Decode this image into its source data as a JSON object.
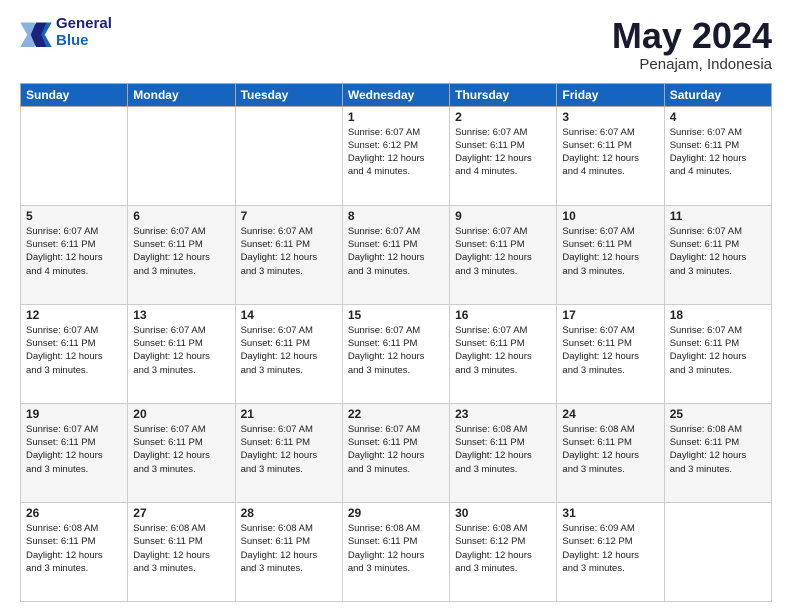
{
  "logo": {
    "line1": "General",
    "line2": "Blue"
  },
  "title": "May 2024",
  "subtitle": "Penajam, Indonesia",
  "weekdays": [
    "Sunday",
    "Monday",
    "Tuesday",
    "Wednesday",
    "Thursday",
    "Friday",
    "Saturday"
  ],
  "weeks": [
    [
      {
        "day": "",
        "info": ""
      },
      {
        "day": "",
        "info": ""
      },
      {
        "day": "",
        "info": ""
      },
      {
        "day": "1",
        "info": "Sunrise: 6:07 AM\nSunset: 6:12 PM\nDaylight: 12 hours\nand 4 minutes."
      },
      {
        "day": "2",
        "info": "Sunrise: 6:07 AM\nSunset: 6:11 PM\nDaylight: 12 hours\nand 4 minutes."
      },
      {
        "day": "3",
        "info": "Sunrise: 6:07 AM\nSunset: 6:11 PM\nDaylight: 12 hours\nand 4 minutes."
      },
      {
        "day": "4",
        "info": "Sunrise: 6:07 AM\nSunset: 6:11 PM\nDaylight: 12 hours\nand 4 minutes."
      }
    ],
    [
      {
        "day": "5",
        "info": "Sunrise: 6:07 AM\nSunset: 6:11 PM\nDaylight: 12 hours\nand 4 minutes."
      },
      {
        "day": "6",
        "info": "Sunrise: 6:07 AM\nSunset: 6:11 PM\nDaylight: 12 hours\nand 3 minutes."
      },
      {
        "day": "7",
        "info": "Sunrise: 6:07 AM\nSunset: 6:11 PM\nDaylight: 12 hours\nand 3 minutes."
      },
      {
        "day": "8",
        "info": "Sunrise: 6:07 AM\nSunset: 6:11 PM\nDaylight: 12 hours\nand 3 minutes."
      },
      {
        "day": "9",
        "info": "Sunrise: 6:07 AM\nSunset: 6:11 PM\nDaylight: 12 hours\nand 3 minutes."
      },
      {
        "day": "10",
        "info": "Sunrise: 6:07 AM\nSunset: 6:11 PM\nDaylight: 12 hours\nand 3 minutes."
      },
      {
        "day": "11",
        "info": "Sunrise: 6:07 AM\nSunset: 6:11 PM\nDaylight: 12 hours\nand 3 minutes."
      }
    ],
    [
      {
        "day": "12",
        "info": "Sunrise: 6:07 AM\nSunset: 6:11 PM\nDaylight: 12 hours\nand 3 minutes."
      },
      {
        "day": "13",
        "info": "Sunrise: 6:07 AM\nSunset: 6:11 PM\nDaylight: 12 hours\nand 3 minutes."
      },
      {
        "day": "14",
        "info": "Sunrise: 6:07 AM\nSunset: 6:11 PM\nDaylight: 12 hours\nand 3 minutes."
      },
      {
        "day": "15",
        "info": "Sunrise: 6:07 AM\nSunset: 6:11 PM\nDaylight: 12 hours\nand 3 minutes."
      },
      {
        "day": "16",
        "info": "Sunrise: 6:07 AM\nSunset: 6:11 PM\nDaylight: 12 hours\nand 3 minutes."
      },
      {
        "day": "17",
        "info": "Sunrise: 6:07 AM\nSunset: 6:11 PM\nDaylight: 12 hours\nand 3 minutes."
      },
      {
        "day": "18",
        "info": "Sunrise: 6:07 AM\nSunset: 6:11 PM\nDaylight: 12 hours\nand 3 minutes."
      }
    ],
    [
      {
        "day": "19",
        "info": "Sunrise: 6:07 AM\nSunset: 6:11 PM\nDaylight: 12 hours\nand 3 minutes."
      },
      {
        "day": "20",
        "info": "Sunrise: 6:07 AM\nSunset: 6:11 PM\nDaylight: 12 hours\nand 3 minutes."
      },
      {
        "day": "21",
        "info": "Sunrise: 6:07 AM\nSunset: 6:11 PM\nDaylight: 12 hours\nand 3 minutes."
      },
      {
        "day": "22",
        "info": "Sunrise: 6:07 AM\nSunset: 6:11 PM\nDaylight: 12 hours\nand 3 minutes."
      },
      {
        "day": "23",
        "info": "Sunrise: 6:08 AM\nSunset: 6:11 PM\nDaylight: 12 hours\nand 3 minutes."
      },
      {
        "day": "24",
        "info": "Sunrise: 6:08 AM\nSunset: 6:11 PM\nDaylight: 12 hours\nand 3 minutes."
      },
      {
        "day": "25",
        "info": "Sunrise: 6:08 AM\nSunset: 6:11 PM\nDaylight: 12 hours\nand 3 minutes."
      }
    ],
    [
      {
        "day": "26",
        "info": "Sunrise: 6:08 AM\nSunset: 6:11 PM\nDaylight: 12 hours\nand 3 minutes."
      },
      {
        "day": "27",
        "info": "Sunrise: 6:08 AM\nSunset: 6:11 PM\nDaylight: 12 hours\nand 3 minutes."
      },
      {
        "day": "28",
        "info": "Sunrise: 6:08 AM\nSunset: 6:11 PM\nDaylight: 12 hours\nand 3 minutes."
      },
      {
        "day": "29",
        "info": "Sunrise: 6:08 AM\nSunset: 6:11 PM\nDaylight: 12 hours\nand 3 minutes."
      },
      {
        "day": "30",
        "info": "Sunrise: 6:08 AM\nSunset: 6:12 PM\nDaylight: 12 hours\nand 3 minutes."
      },
      {
        "day": "31",
        "info": "Sunrise: 6:09 AM\nSunset: 6:12 PM\nDaylight: 12 hours\nand 3 minutes."
      },
      {
        "day": "",
        "info": ""
      }
    ]
  ]
}
